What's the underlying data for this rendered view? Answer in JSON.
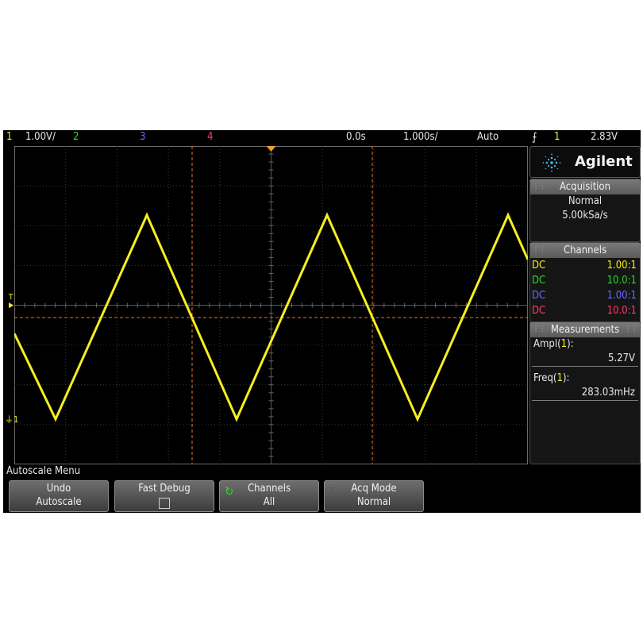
{
  "status_bar": {
    "ch1_num": "1",
    "ch1_scale": "1.00V/",
    "ch2_num": "2",
    "ch3_num": "3",
    "ch4_num": "4",
    "time_delay": "0.0s",
    "time_scale": "1.000s/",
    "trigger_mode": "Auto",
    "trigger_slope_icon": "rising-edge-icon",
    "trigger_source": "1",
    "trigger_level": "2.83V"
  },
  "waveform": {
    "trigger_marker": "T",
    "ground_marker": "1",
    "amplitude_v": 5.27,
    "frequency_mhz": 283.03
  },
  "logo": {
    "brand": "Agilent",
    "icon": "agilent-spark-icon"
  },
  "acquisition": {
    "title": "Acquisition",
    "mode": "Normal",
    "rate": "5.00kSa/s"
  },
  "channels": {
    "title": "Channels",
    "rows": [
      {
        "coupling": "DC",
        "ratio": "1.00:1",
        "color": "#f5ef1f"
      },
      {
        "coupling": "DC",
        "ratio": "10.0:1",
        "color": "#2fd52f"
      },
      {
        "coupling": "DC",
        "ratio": "1.00:1",
        "color": "#6a6aff"
      },
      {
        "coupling": "DC",
        "ratio": "10.0:1",
        "color": "#ff3a6a"
      }
    ]
  },
  "measurements": {
    "title": "Measurements",
    "ampl_label": "Ampl(",
    "ampl_ch": "1",
    "ampl_close": "):",
    "ampl_value": "5.27V",
    "freq_label": "Freq(",
    "freq_ch": "1",
    "freq_close": "):",
    "freq_value": "283.03mHz"
  },
  "menu": {
    "title": "Autoscale Menu",
    "keys": [
      {
        "line1": "Undo",
        "line2": "Autoscale"
      },
      {
        "line1": "Fast Debug",
        "line2": ""
      },
      {
        "line1": "Channels",
        "line2": "All",
        "icon": "rotate-knob-icon"
      },
      {
        "line1": "Acq Mode",
        "line2": "Normal",
        "icon": "rotate-knob-icon"
      }
    ]
  },
  "colors": {
    "ch1": "#f5ef1f",
    "ch2": "#2fd52f",
    "ch3": "#6a6aff",
    "ch4": "#ff3a6a",
    "cursor": "#e8762a",
    "grid": "#3a3a3a"
  }
}
